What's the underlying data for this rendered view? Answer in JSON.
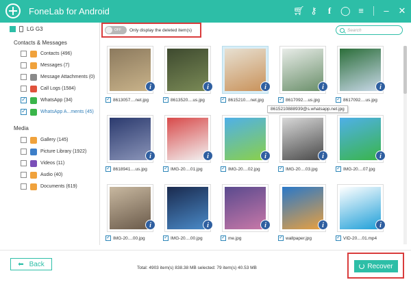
{
  "app": {
    "title": "FoneLab for Android",
    "accent_color": "#2dbea7",
    "title_icons": [
      "cart-icon",
      "key-icon",
      "facebook-icon",
      "chat-icon",
      "menu-icon",
      "minimize-icon",
      "close-icon"
    ]
  },
  "sidebar": {
    "device": "LG G3",
    "sections": [
      {
        "label": "Contacts & Messages",
        "items": [
          {
            "label": "Contacts (496)",
            "checked": false,
            "icon": "contacts-icon",
            "color": "#f0a23c"
          },
          {
            "label": "Messages (7)",
            "checked": false,
            "icon": "messages-icon",
            "color": "#f0a23c"
          },
          {
            "label": "Message Attachments (0)",
            "checked": false,
            "icon": "attachment-icon",
            "color": "#8a8a8a"
          },
          {
            "label": "Call Logs (1584)",
            "checked": false,
            "icon": "call-icon",
            "color": "#e0523c"
          },
          {
            "label": "WhatsApp (34)",
            "checked": true,
            "icon": "whatsapp-icon",
            "color": "#3ab54a"
          },
          {
            "label": "WhatsApp A...ments (45)",
            "checked": true,
            "icon": "whatsapp-attachment-icon",
            "color": "#3ab54a",
            "active": true
          }
        ]
      },
      {
        "label": "Media",
        "items": [
          {
            "label": "Gallery (145)",
            "checked": false,
            "icon": "gallery-icon",
            "color": "#f0a23c"
          },
          {
            "label": "Picture Library (1922)",
            "checked": false,
            "icon": "picture-library-icon",
            "color": "#3d7fc8"
          },
          {
            "label": "Videos (11)",
            "checked": false,
            "icon": "video-icon",
            "color": "#7a4fb8"
          },
          {
            "label": "Audio (40)",
            "checked": false,
            "icon": "audio-icon",
            "color": "#f0a23c"
          },
          {
            "label": "Documents (619)",
            "checked": false,
            "icon": "documents-icon",
            "color": "#f0a23c"
          }
        ]
      }
    ]
  },
  "toolbar": {
    "toggle_label": "OFF",
    "filter_text": "Only display the deleted item(s)",
    "search_placeholder": "Search"
  },
  "files": [
    {
      "name": "8613057....net.jpg",
      "checked": true,
      "colors": [
        "#8c7a5e",
        "#c9b38a"
      ]
    },
    {
      "name": "8613520....us.jpg",
      "checked": true,
      "colors": [
        "#3e4a2f",
        "#7a8a56"
      ]
    },
    {
      "name": "8615210....net.jpg",
      "checked": true,
      "colors": [
        "#e7e0d2",
        "#c9925a"
      ],
      "selected": true
    },
    {
      "name": "8617092....us.jpg",
      "checked": true,
      "colors": [
        "#e8ece8",
        "#6a8f6a"
      ]
    },
    {
      "name": "8617092....us.jpg",
      "checked": true,
      "colors": [
        "#2c6e3a",
        "#c8d8e8"
      ]
    },
    {
      "name": "8618941....us.jpg",
      "checked": true,
      "colors": [
        "#2b3a6e",
        "#8a94b8"
      ]
    },
    {
      "name": "IMG-20....01.jpg",
      "checked": true,
      "colors": [
        "#d84a4a",
        "#f2f2f2"
      ]
    },
    {
      "name": "IMG-20....02.jpg",
      "checked": true,
      "colors": [
        "#4fb0e8",
        "#8ad04a"
      ]
    },
    {
      "name": "IMG-20....03.jpg",
      "checked": true,
      "colors": [
        "#d8d8d8",
        "#4a4a4a"
      ]
    },
    {
      "name": "IMG-20....07.jpg",
      "checked": true,
      "colors": [
        "#4fb0e8",
        "#3ab54a"
      ]
    },
    {
      "name": "IMG-20....00.jpg",
      "checked": true,
      "colors": [
        "#c8b8a0",
        "#6a5a4a"
      ]
    },
    {
      "name": "IMG-20....00.jpg",
      "checked": true,
      "colors": [
        "#1a2a4e",
        "#4a8ac8"
      ]
    },
    {
      "name": "me.jpg",
      "checked": true,
      "colors": [
        "#5a4a8e",
        "#c878a8"
      ]
    },
    {
      "name": "wallpaper.jpg",
      "checked": true,
      "colors": [
        "#2a78c8",
        "#e8a040"
      ]
    },
    {
      "name": "VID-20....01.mp4",
      "checked": true,
      "colors": [
        "#ffffff",
        "#1f9fd8"
      ]
    }
  ],
  "tooltip": "8615210888939@s.whatsapp.net.jpg",
  "footer": {
    "back_label": "Back",
    "summary": "Total: 4903 item(s) 838.38 MB   selected: 79 item(s) 40.53 MB",
    "recover_label": "Recover"
  }
}
